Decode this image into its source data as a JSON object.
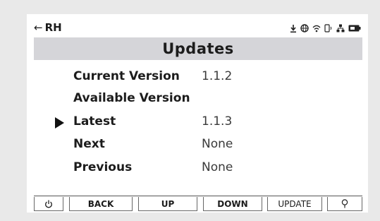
{
  "statusbar": {
    "back_label": "RH",
    "icons": [
      "download-icon",
      "globe-icon",
      "wifi-icon",
      "phone-icon",
      "network-icon",
      "battery-icon"
    ]
  },
  "header": {
    "title": "Updates"
  },
  "rows": [
    {
      "label": "Current Version",
      "value": "1.1.2",
      "selected": false
    },
    {
      "label": "Available Version",
      "value": "",
      "selected": false
    },
    {
      "label": "Latest",
      "value": "1.1.3",
      "selected": true
    },
    {
      "label": "Next",
      "value": "None",
      "selected": false
    },
    {
      "label": "Previous",
      "value": "None",
      "selected": false
    }
  ],
  "softkeys": {
    "power_icon": "power-icon",
    "back": "BACK",
    "up": "UP",
    "down": "DOWN",
    "update": "UPDATE",
    "light_icon": "lightbulb-icon"
  },
  "colors": {
    "background": "#e9e9e9",
    "screen": "#ffffff",
    "title_bar": "#d5d5d9",
    "text": "#1c1c1c"
  }
}
